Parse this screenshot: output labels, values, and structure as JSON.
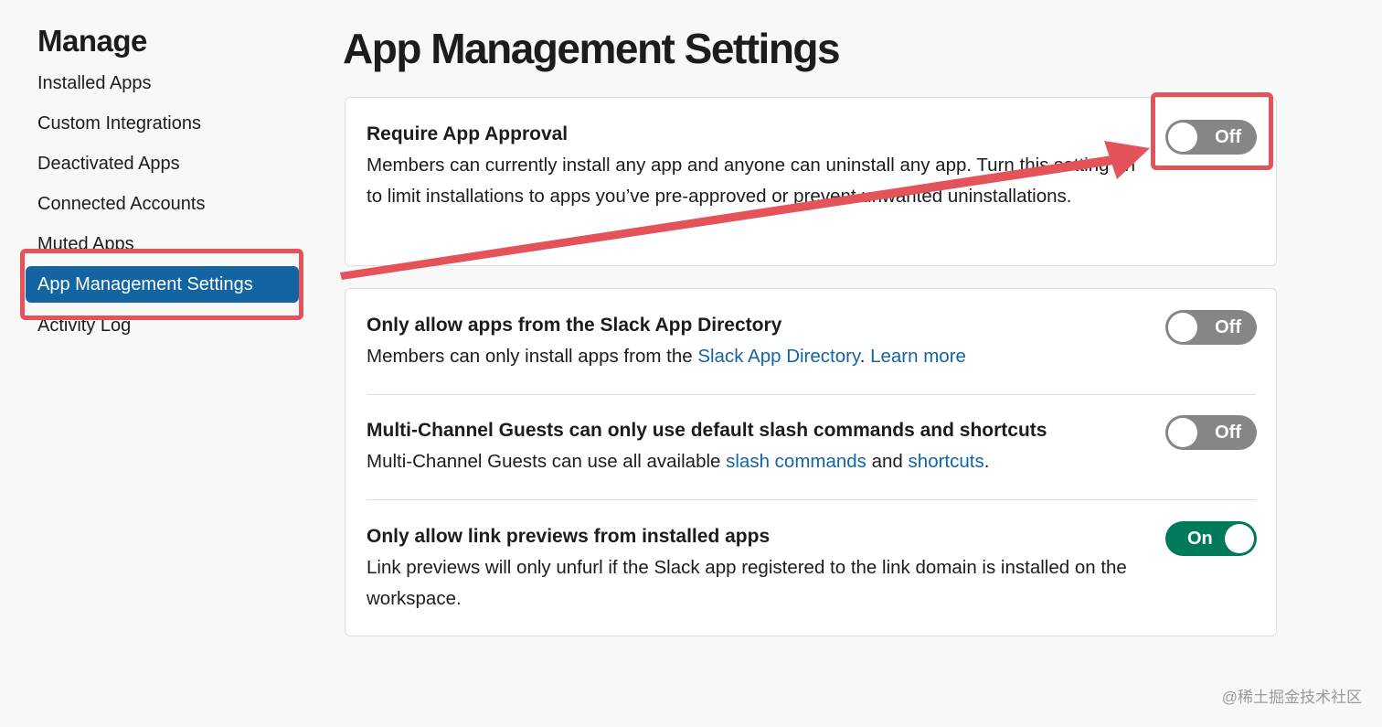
{
  "sidebar": {
    "title": "Manage",
    "items": [
      {
        "label": "Installed Apps"
      },
      {
        "label": "Custom Integrations"
      },
      {
        "label": "Deactivated Apps"
      },
      {
        "label": "Connected Accounts"
      },
      {
        "label": "Muted Apps"
      },
      {
        "label": "App Management Settings",
        "active": true
      },
      {
        "label": "Activity Log"
      }
    ]
  },
  "main": {
    "title": "App Management Settings",
    "settings": [
      {
        "title": "Require App Approval",
        "description": "Members can currently install any app and anyone can uninstall any app. Turn this setting on to limit installations to apps you’ve pre-approved or prevent unwanted uninstallations.",
        "toggle": {
          "state": "off",
          "label": "Off"
        }
      },
      {
        "title": "Only allow apps from the Slack App Directory",
        "description_prefix": "Members can only install apps from the ",
        "link_1": "Slack App Directory",
        "separator": ". ",
        "link_2": "Learn more",
        "toggle": {
          "state": "off",
          "label": "Off"
        }
      },
      {
        "title": "Multi-Channel Guests can only use default slash commands and shortcuts",
        "description_prefix": "Multi-Channel Guests can use all available ",
        "link_1": "slash commands",
        "middle": " and ",
        "link_2": "shortcuts",
        "suffix": ".",
        "toggle": {
          "state": "off",
          "label": "Off"
        }
      },
      {
        "title": "Only allow link previews from installed apps",
        "description": "Link previews will only unfurl if the Slack app registered to the link domain is installed on the workspace.",
        "toggle": {
          "state": "on",
          "label": "On"
        }
      }
    ]
  },
  "annotation": {
    "color": "#e4525a"
  },
  "colors": {
    "accent": "#1264a3",
    "toggle_on": "#007a5a",
    "toggle_off": "#868686"
  },
  "watermark": "@稀土掘金技术社区"
}
